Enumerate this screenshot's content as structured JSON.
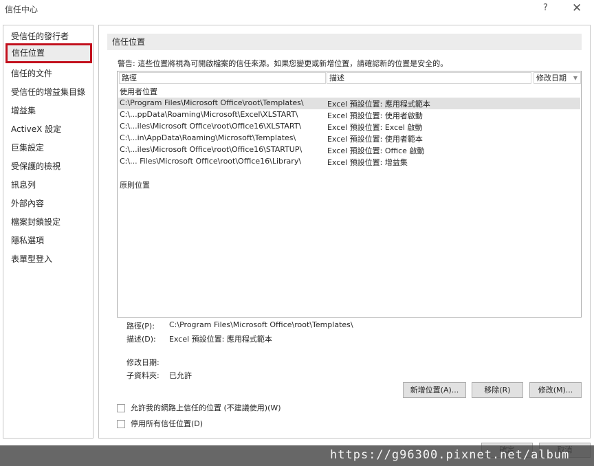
{
  "window": {
    "title": "信任中心",
    "help": "?",
    "close": "✕"
  },
  "sidebar": {
    "items": [
      {
        "label": "受信任的發行者"
      },
      {
        "label": "信任位置"
      },
      {
        "label": "信任的文件"
      },
      {
        "label": "受信任的增益集目錄"
      },
      {
        "label": "增益集"
      },
      {
        "label": "ActiveX 設定"
      },
      {
        "label": "巨集設定"
      },
      {
        "label": "受保護的檢視"
      },
      {
        "label": "訊息列"
      },
      {
        "label": "外部內容"
      },
      {
        "label": "檔案封鎖設定"
      },
      {
        "label": "隱私選項"
      },
      {
        "label": "表單型登入"
      }
    ],
    "active_index": 1,
    "active_border_color": "#c2101d"
  },
  "main": {
    "section_title": "信任位置",
    "warning": "警告: 這些位置將視為可開啟檔案的信任來源。如果您變更或新增位置，請確認新的位置是安全的。",
    "columns": {
      "path": "路徑",
      "desc": "描述",
      "modified": "修改日期",
      "sort_icon": "▼"
    },
    "user_group": "使用者位置",
    "policy_group": "原則位置",
    "rows": [
      {
        "path": "C:\\Program Files\\Microsoft Office\\root\\Templates\\",
        "desc": "Excel 預設位置: 應用程式範本",
        "selected": true
      },
      {
        "path": "C:\\...ppData\\Roaming\\Microsoft\\Excel\\XLSTART\\",
        "desc": "Excel 預設位置: 使用者啟動"
      },
      {
        "path": "C:\\...iles\\Microsoft Office\\root\\Office16\\XLSTART\\",
        "desc": "Excel 預設位置: Excel 啟動"
      },
      {
        "path": "C:\\...in\\AppData\\Roaming\\Microsoft\\Templates\\",
        "desc": "Excel 預設位置: 使用者範本"
      },
      {
        "path": "C:\\...iles\\Microsoft Office\\root\\Office16\\STARTUP\\",
        "desc": "Excel 預設位置: Office 啟動"
      },
      {
        "path": "C:\\... Files\\Microsoft Office\\root\\Office16\\Library\\",
        "desc": "Excel 預設位置: 增益集"
      }
    ],
    "details": {
      "path_label": "路徑(P):",
      "path_value": "C:\\Program Files\\Microsoft Office\\root\\Templates\\",
      "desc_label": "描述(D):",
      "desc_value": "Excel 預設位置: 應用程式範本",
      "modified_label": "修改日期:",
      "modified_value": "",
      "subfolders_label": "子資料夾:",
      "subfolders_value": "已允許"
    },
    "buttons": {
      "add": "新增位置(A)...",
      "remove": "移除(R)",
      "modify": "修改(M)..."
    },
    "checkboxes": [
      {
        "label": "允許我的網路上信任的位置 (不建議使用)(W)",
        "checked": false
      },
      {
        "label": "停用所有信任位置(D)",
        "checked": false
      }
    ]
  },
  "footer": {
    "ok": "確定",
    "cancel": "取消"
  },
  "watermark": "https://g96300.pixnet.net/album"
}
